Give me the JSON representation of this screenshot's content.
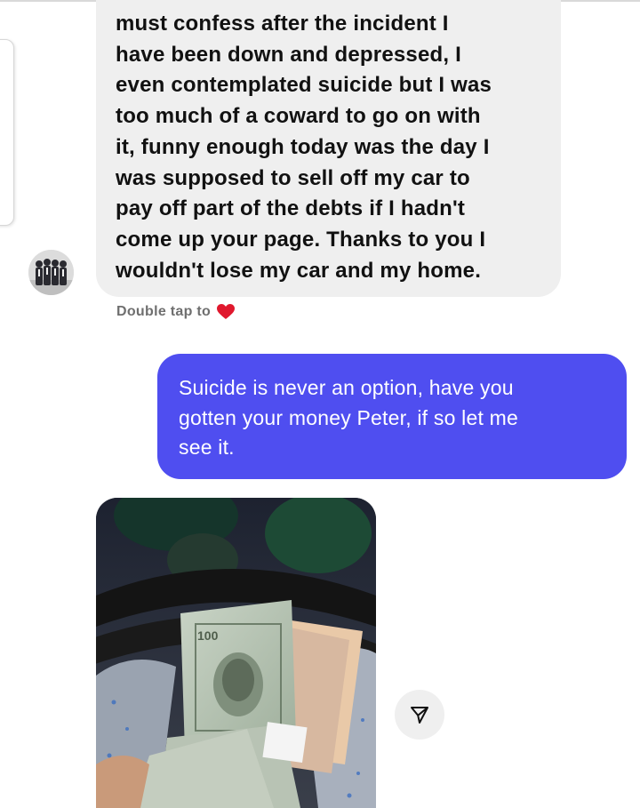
{
  "messages": {
    "received": {
      "text": "must confess after the incident I\nhave been down and depressed, I\neven contemplated suicide but I was\ntoo much of a coward to go on with\nit, funny enough today was the day I\nwas supposed to sell off my car to\npay off part of the debts if I hadn't\ncome up your page. Thanks to you I\nwouldn't lose my car and my home."
    },
    "reaction_hint": {
      "label": "Double tap to"
    },
    "sent": {
      "text": "Suicide is never an option, have you\ngotten your money Peter, if so let me\nsee it."
    }
  },
  "icons": {
    "reaction": "heart-icon",
    "share": "send-icon"
  },
  "colors": {
    "received_bubble": "#efefef",
    "sent_bubble": "#4f4ef0",
    "heart": "#e0182d",
    "hint_text": "#6f6f6f"
  }
}
